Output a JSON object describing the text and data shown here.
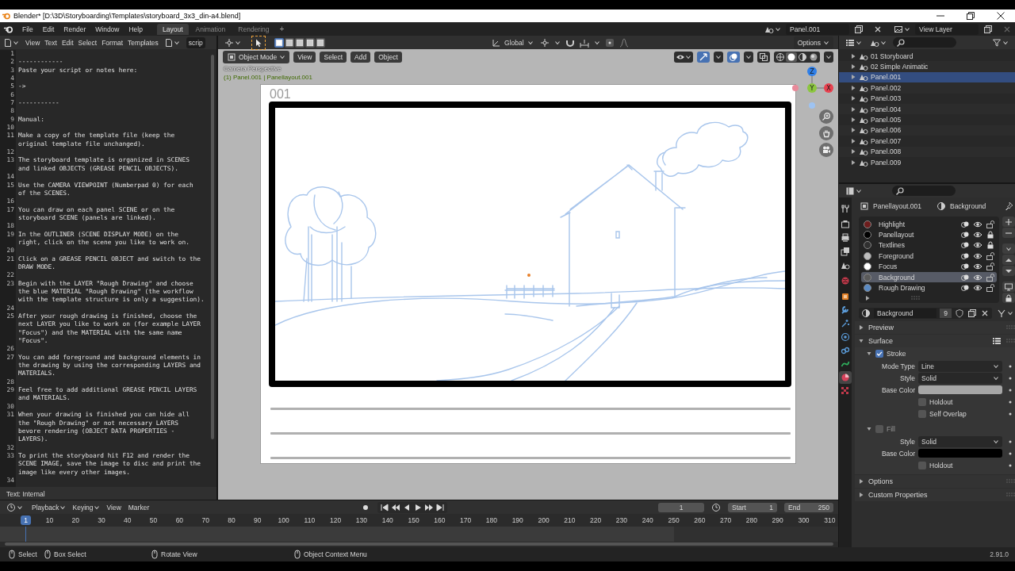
{
  "window": {
    "title": "Blender* [D:\\3D\\Storyboarding\\Templates\\storyboard_3x3_din-a4.blend]"
  },
  "topbar": {
    "menus": [
      "File",
      "Edit",
      "Render",
      "Window",
      "Help"
    ],
    "workspaces": [
      {
        "label": "Layout",
        "selected": true
      },
      {
        "label": "Animation",
        "selected": false
      },
      {
        "label": "Rendering",
        "selected": false
      }
    ],
    "add_workspace": "+",
    "scene": "Panel.001",
    "view_layer": "View Layer"
  },
  "text_editor": {
    "menus": [
      "View",
      "Text",
      "Edit",
      "Select",
      "Format",
      "Templates"
    ],
    "datablock": "scrip",
    "lines": [
      {
        "number": "1"
      },
      {
        "number": "2",
        "text": [
          "------------"
        ]
      },
      {
        "number": "3",
        "text": [
          "Paste your script or notes here:"
        ]
      },
      {
        "number": "4"
      },
      {
        "number": "5",
        "text": [
          "->"
        ]
      },
      {
        "number": "6"
      },
      {
        "number": "7",
        "text": [
          "-----------"
        ]
      },
      {
        "number": "8"
      },
      {
        "number": "9",
        "text": [
          "Manual:"
        ]
      },
      {
        "number": "10"
      },
      {
        "number": "11",
        "text": [
          "Make a copy of the template file (keep the",
          "original template file unchanged)."
        ]
      },
      {
        "number": "12"
      },
      {
        "number": "13",
        "text": [
          "The storyboard template is organized in SCENES",
          "and linked OBJECTS (GREASE PENCIL OBJECTS)."
        ]
      },
      {
        "number": "14"
      },
      {
        "number": "15",
        "text": [
          "Use the CAMERA VIEWPOINT (Numberpad 0) for each",
          "of the SCENES."
        ]
      },
      {
        "number": "16"
      },
      {
        "number": "17",
        "text": [
          "You can draw on each panel SCENE or on the",
          "storyboard SCENE (panels are linked)."
        ]
      },
      {
        "number": "18"
      },
      {
        "number": "19",
        "text": [
          "In the OUTLINER (SCENE DISPLAY MODE) on the",
          "right, click on the scene you like to work on."
        ]
      },
      {
        "number": "20"
      },
      {
        "number": "21",
        "text": [
          "Click on a GREASE PENCIL OBJECT and switch to the",
          "DRAW MODE."
        ]
      },
      {
        "number": "22"
      },
      {
        "number": "23",
        "text": [
          "Begin with the LAYER \"Rough Drawing\" and choose",
          "the blue MATERIAL \"Rough Drawing\" (the workflow",
          "with the template structure is only a suggestion)."
        ]
      },
      {
        "number": "24"
      },
      {
        "number": "25",
        "text": [
          "After your rough drawing is finished, choose the",
          "next LAYER you like to work on (for example LAYER",
          "\"Focus\") and the MATERIAL with the same name",
          "\"Focus\"."
        ]
      },
      {
        "number": "26"
      },
      {
        "number": "27",
        "text": [
          "You can add foreground and background elements in",
          "the drawing by using the corresponding LAYERS and",
          "MATERIALS."
        ]
      },
      {
        "number": "28"
      },
      {
        "number": "29",
        "text": [
          "Feel free to add additional GREASE PENCIL LAYERS",
          "and MATERIALS."
        ]
      },
      {
        "number": "30"
      },
      {
        "number": "31",
        "text": [
          "When your drawing is finished you can hide all",
          "the \"Rough Drawing\" or not necessary LAYERS",
          "bevore rendering (OBJECT DATA PROPERTIES -",
          "LAYERS)."
        ]
      },
      {
        "number": "32"
      },
      {
        "number": "33",
        "text": [
          "To print the storyboard hit F12 and render the",
          "SCENE IMAGE, save the image to disc and print the",
          "image like every other images."
        ]
      },
      {
        "number": "34"
      }
    ],
    "footer": "Text: Internal"
  },
  "viewport": {
    "select_modes": [
      {
        "kind": "set",
        "selected": true
      },
      {
        "kind": "extend",
        "selected": false
      },
      {
        "kind": "subtract",
        "selected": false
      },
      {
        "kind": "invert",
        "selected": false
      },
      {
        "kind": "intersect",
        "selected": false
      }
    ],
    "orientation": "Global",
    "options": "Options",
    "mode": "Object Mode",
    "menus": [
      "View",
      "Select",
      "Add",
      "Object"
    ],
    "toggles": [
      {
        "kind": "gizmo",
        "on": true
      },
      {
        "kind": "overlay",
        "on": true
      },
      {
        "kind": "xray",
        "on": false
      }
    ],
    "shading": [
      {
        "kind": "wireframe",
        "selected": false
      },
      {
        "kind": "solid",
        "selected": true
      },
      {
        "kind": "material",
        "selected": false
      },
      {
        "kind": "rendered",
        "selected": false
      }
    ],
    "camera_label": "Camera Perspective",
    "object_label": "(1) Panel.001 | Panellayout.001",
    "panel_number": "001",
    "axes": [
      "Z",
      "Y",
      "X"
    ]
  },
  "outliner": {
    "items": [
      {
        "label": "01 Storyboard",
        "selected": false
      },
      {
        "label": "02 Simple Animatic",
        "selected": false
      },
      {
        "label": "Panel.001",
        "selected": true
      },
      {
        "label": "Panel.002",
        "selected": false
      },
      {
        "label": "Panel.003",
        "selected": false
      },
      {
        "label": "Panel.004",
        "selected": false
      },
      {
        "label": "Panel.005",
        "selected": false
      },
      {
        "label": "Panel.006",
        "selected": false
      },
      {
        "label": "Panel.007",
        "selected": false
      },
      {
        "label": "Panel.008",
        "selected": false
      },
      {
        "label": "Panel.009",
        "selected": false
      }
    ]
  },
  "properties": {
    "tabs": [
      {
        "kind": "tool",
        "selected": false
      },
      {
        "kind": "render",
        "selected": false
      },
      {
        "kind": "output",
        "selected": false
      },
      {
        "kind": "viewlayer",
        "selected": false
      },
      {
        "kind": "scene",
        "selected": false
      },
      {
        "kind": "world",
        "selected": false
      },
      {
        "kind": "object",
        "selected": false
      },
      {
        "kind": "modifier",
        "selected": false
      },
      {
        "kind": "effects",
        "selected": false
      },
      {
        "kind": "physics",
        "selected": false
      },
      {
        "kind": "constraint",
        "selected": false
      },
      {
        "kind": "data",
        "selected": false
      },
      {
        "kind": "material",
        "selected": true
      },
      {
        "kind": "texture",
        "selected": false
      }
    ],
    "object": "Panellayout.001",
    "material": "Background",
    "slots": [
      {
        "name": "Highlight",
        "color": "#6e1d1d",
        "locked": false,
        "selected": false
      },
      {
        "name": "Panellayout",
        "color": "#000000",
        "locked": true,
        "selected": false
      },
      {
        "name": "Textlines",
        "color": "#303030",
        "locked": true,
        "selected": false
      },
      {
        "name": "Foreground",
        "color": "#bdbdbd",
        "locked": false,
        "selected": false
      },
      {
        "name": "Focus",
        "color": "#ffffff",
        "locked": false,
        "selected": false
      },
      {
        "name": "Background",
        "color": "#5a5a5a",
        "locked": false,
        "selected": true
      },
      {
        "name": "Rough Drawing",
        "color": "#5b8bc4",
        "locked": false,
        "selected": false
      }
    ],
    "material_field": {
      "name": "Background",
      "users": "9"
    },
    "sections": [
      {
        "label": "Preview",
        "expanded": false
      },
      {
        "label": "Surface",
        "expanded": true,
        "subpanels": [
          {
            "label": "Stroke",
            "enabled": true,
            "expanded": true,
            "rows": [
              {
                "kind": "dropdown",
                "label": "Mode Type",
                "value": "Line"
              },
              {
                "kind": "dropdown",
                "label": "Style",
                "value": "Solid"
              },
              {
                "kind": "color",
                "label": "Base Color",
                "color": "#a6a6a6"
              },
              {
                "kind": "checkbox",
                "label": "Holdout",
                "checked": false
              },
              {
                "kind": "checkbox",
                "label": "Self Overlap",
                "checked": false
              }
            ]
          },
          {
            "label": "Fill",
            "enabled": false,
            "expanded": true,
            "rows": [
              {
                "kind": "dropdown",
                "label": "Style",
                "value": "Solid"
              },
              {
                "kind": "color",
                "label": "Base Color",
                "color": "#000000"
              },
              {
                "kind": "checkbox",
                "label": "Holdout",
                "checked": false
              }
            ]
          }
        ]
      },
      {
        "label": "Options",
        "expanded": false
      },
      {
        "label": "Custom Properties",
        "expanded": false
      }
    ]
  },
  "timeline": {
    "menus": [
      "Playback",
      "Keying",
      "View",
      "Marker"
    ],
    "frame": "1",
    "start_label": "Start",
    "start": "1",
    "end_label": "End",
    "end": "250",
    "current_frame": "1",
    "ruler": [
      "10",
      "20",
      "30",
      "40",
      "50",
      "60",
      "70",
      "80",
      "90",
      "100",
      "110",
      "120",
      "130",
      "140",
      "150",
      "160",
      "170",
      "180",
      "190",
      "200",
      "210",
      "220",
      "230",
      "240",
      "250",
      "260",
      "270",
      "280",
      "290",
      "300",
      "310"
    ]
  },
  "status_bar": {
    "hints": [
      {
        "label": "Select"
      },
      {
        "label": "Box Select"
      },
      {
        "label": "Rotate View"
      },
      {
        "label": "Object Context Menu"
      }
    ],
    "version": "2.91.0"
  }
}
